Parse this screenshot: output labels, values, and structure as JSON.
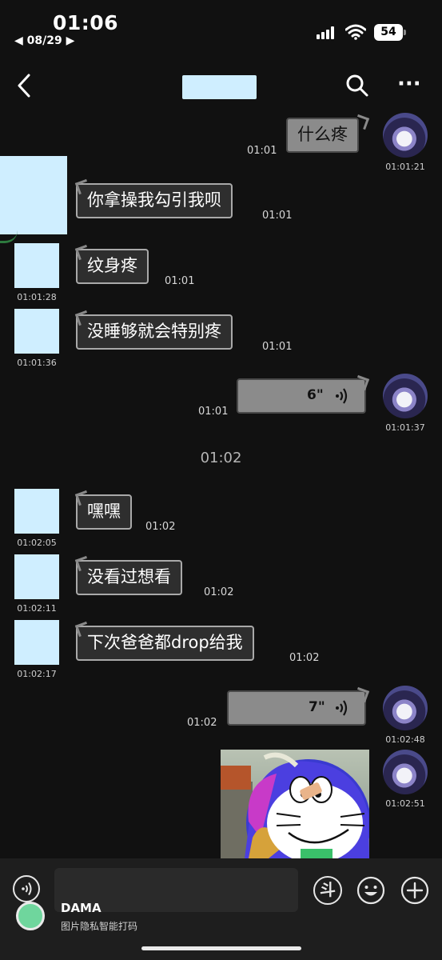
{
  "status_bar": {
    "time": "01:06",
    "back_app": "◀ 08/29 ▶",
    "battery": "54"
  },
  "nav": {
    "back_icon": "chevron-left-icon",
    "search_icon": "search-icon",
    "more_label": "···"
  },
  "messages": [
    {
      "side": "right",
      "type": "text",
      "text": "什么疼",
      "time": "01:01",
      "avatar_time": "01:01:21"
    },
    {
      "side": "left",
      "type": "text",
      "text": "你拿操我勾引我呗",
      "time": "01:01"
    },
    {
      "side": "left",
      "type": "text",
      "text": "纹身疼",
      "time": "01:01",
      "avatar_time": "01:01:28"
    },
    {
      "side": "left",
      "type": "text",
      "text": "没睡够就会特别疼",
      "time": "01:01",
      "avatar_time": "01:01:36"
    },
    {
      "side": "right",
      "type": "voice",
      "duration": "6\"",
      "time": "01:01",
      "avatar_time": "01:01:37"
    },
    {
      "side": "left",
      "type": "text",
      "text": "嘿嘿",
      "time": "01:02",
      "avatar_time": "01:02:05"
    },
    {
      "side": "left",
      "type": "text",
      "text": "没看过想看",
      "time": "01:02",
      "avatar_time": "01:02:11"
    },
    {
      "side": "left",
      "type": "text",
      "text": "下次爸爸都drop给我",
      "time": "01:02",
      "avatar_time": "01:02:17"
    },
    {
      "side": "right",
      "type": "voice",
      "duration": "7\"",
      "time": "01:02",
      "avatar_time": "01:02:48"
    },
    {
      "side": "right",
      "type": "image",
      "avatar_time": "01:02:51"
    }
  ],
  "divider_time": "01:02",
  "bottom_bar": {
    "dou_label": "斗",
    "watermark_title": "DAMA",
    "watermark_subtitle": "图片隐私智能打码"
  },
  "colors": {
    "background": "#111111",
    "cover_blue": "#cfeeff",
    "bubble_other": "#2e2e2e",
    "bubble_me": "#8b8b8b"
  }
}
